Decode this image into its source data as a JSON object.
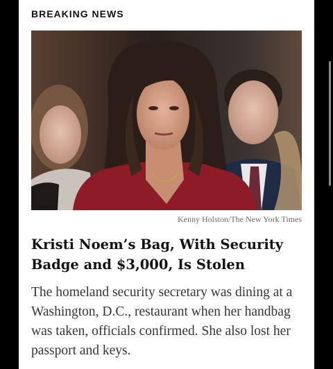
{
  "section": {
    "label": "BREAKING NEWS"
  },
  "article": {
    "photo_credit": "Kenny Holston/The New York Times",
    "headline": "Kristi Noem’s Bag, With Security Badge and $3,000, Is Stolen",
    "summary": "The homeland security secretary was dining at a Washington, D.C., restaurant when her handbag was taken, officials confirmed. She also lost her passport and keys."
  },
  "colors": {
    "page_background": "#000000",
    "card_background": "#ffffff",
    "headline_text": "#121212",
    "summary_text": "#363636",
    "credit_text": "#6b6b6b"
  }
}
